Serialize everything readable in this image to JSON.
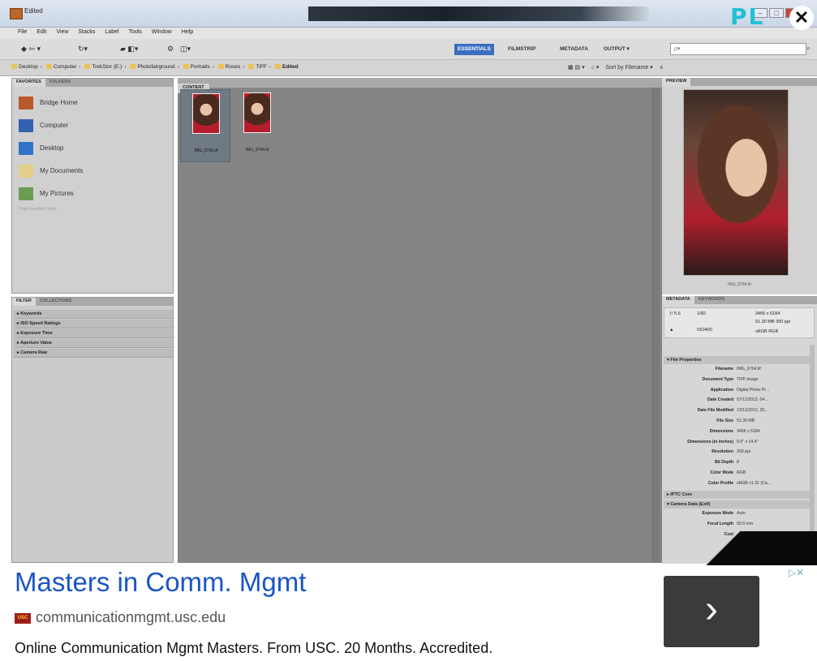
{
  "window": {
    "title": "Edited",
    "controls": [
      "–",
      "□",
      "✕"
    ]
  },
  "menu": [
    "File",
    "Edit",
    "View",
    "Stacks",
    "Label",
    "Tools",
    "Window",
    "Help"
  ],
  "workspaces": [
    "ESSENTIALS",
    "FILMSTRIP",
    "METADATA",
    "OUTPUT ▾"
  ],
  "search": {
    "placeholder": "ρ▾"
  },
  "path": [
    {
      "label": "Desktop"
    },
    {
      "label": "Computer"
    },
    {
      "label": "TrekStor (E:)"
    },
    {
      "label": "Photofairground"
    },
    {
      "label": "Portraits"
    },
    {
      "label": "Roses"
    },
    {
      "label": "TIFF"
    },
    {
      "label": "Edited"
    }
  ],
  "viewtools": [
    "▦ ▤ ▾",
    "⌂ ▾",
    "Sort by Filename ▾",
    "∧"
  ],
  "favorites": {
    "tabs": [
      "FAVORITES",
      "FOLDERS"
    ],
    "items": [
      {
        "label": "Bridge Home",
        "color": "#b85a2a"
      },
      {
        "label": "Computer",
        "color": "#3461b0"
      },
      {
        "label": "Desktop",
        "color": "#2f73c8"
      },
      {
        "label": "My Documents",
        "color": "#e4cf8a"
      },
      {
        "label": "My Pictures",
        "color": "#6a9c52"
      }
    ],
    "hint": "Drag Favorites Here..."
  },
  "filter": {
    "tabs": [
      "FILTER",
      "COLLECTIONS"
    ],
    "items": [
      "Keywords",
      "ISO Speed Ratings",
      "Exposure Time",
      "Aperture Value",
      "Camera Raw"
    ]
  },
  "content": {
    "tab": "CONTENT",
    "thumbs": [
      {
        "name": "IMG_9763.tif"
      },
      {
        "name": "IMG_9764.tif"
      }
    ]
  },
  "preview": {
    "tab": "PREVIEW",
    "caption": "IMG_9764.tif"
  },
  "metadata": {
    "tabs": [
      "METADATA",
      "KEYWORDS"
    ],
    "summary": {
      "aperture": "ƒ/ 5.6",
      "shutter": "1/60",
      "iso": "ISO400",
      "dims": "3456 x 5184",
      "size": "51.30 MB  300 ppi",
      "mode": "sRGB   RGB"
    },
    "sections": {
      "file": "File Properties",
      "iptc": "IPTC Core",
      "camera": "Camera Data (Exif)"
    },
    "file_props": [
      {
        "k": "Filename",
        "v": "IMG_9764.tif"
      },
      {
        "k": "Document Type",
        "v": "TIFF image"
      },
      {
        "k": "Application",
        "v": "Digital Photo Pr..."
      },
      {
        "k": "Date Created",
        "v": "07/11/2013, 04..."
      },
      {
        "k": "Date File Modified",
        "v": "13/11/2013, 20..."
      },
      {
        "k": "File Size",
        "v": "51.30 MB"
      },
      {
        "k": "Dimensions",
        "v": "3456 x 5184"
      },
      {
        "k": "Dimensions (in inches)",
        "v": "9.6\" x 14.4\""
      },
      {
        "k": "Resolution",
        "v": "300 ppi"
      },
      {
        "k": "Bit Depth",
        "v": "8"
      },
      {
        "k": "Color Mode",
        "v": "RGB"
      },
      {
        "k": "Color Profile",
        "v": "sRGB v1.31 (Ca..."
      }
    ],
    "camera_props": [
      {
        "k": "Exposure Mode",
        "v": "Auto"
      },
      {
        "k": "Focal Length",
        "v": "50.0 mm"
      },
      {
        "k": "Cust",
        "v": ""
      }
    ]
  },
  "overlay": {
    "text": "PL",
    "close": "✕"
  },
  "ad": {
    "title": "Masters in Comm. Mgmt",
    "logo": "USC",
    "domain": "communicationmgmt.usc.edu",
    "description": "Online Communication Mgmt Masters. From USC. 20 Months. Accredited.",
    "arrow": "›",
    "choices": "▷✕"
  }
}
